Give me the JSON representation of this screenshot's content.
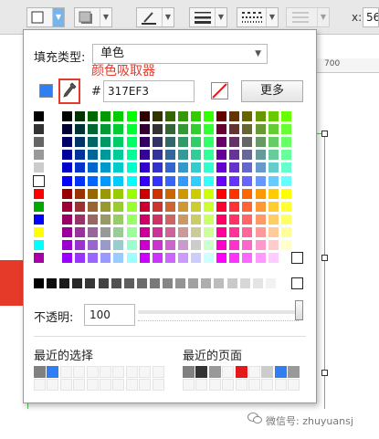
{
  "toolbar": {
    "x_label": "x:",
    "x_value": "56"
  },
  "ruler": {
    "mark": "700"
  },
  "panel": {
    "fill_type_label": "填充类型:",
    "fill_type_value": "单色",
    "annotation": "颜色吸取器",
    "current_color": "#317EF3",
    "hash": "#",
    "hex_value": "317EF3",
    "more_button": "更多",
    "opacity_label": "不透明:",
    "opacity_value": "100",
    "opacity_fraction": 1.0,
    "recent_selection_label": "最近的选择",
    "recent_page_label": "最近的页面",
    "recent_selection_colors": [
      "#808080",
      "#317EF3"
    ],
    "recent_page_colors": [
      "#808080",
      "#333333",
      "#999999",
      "",
      "#e41a1a",
      "",
      "#cccccc",
      "#317EF3",
      "#999999"
    ]
  },
  "watermark": "微信号: zhuyuansj"
}
